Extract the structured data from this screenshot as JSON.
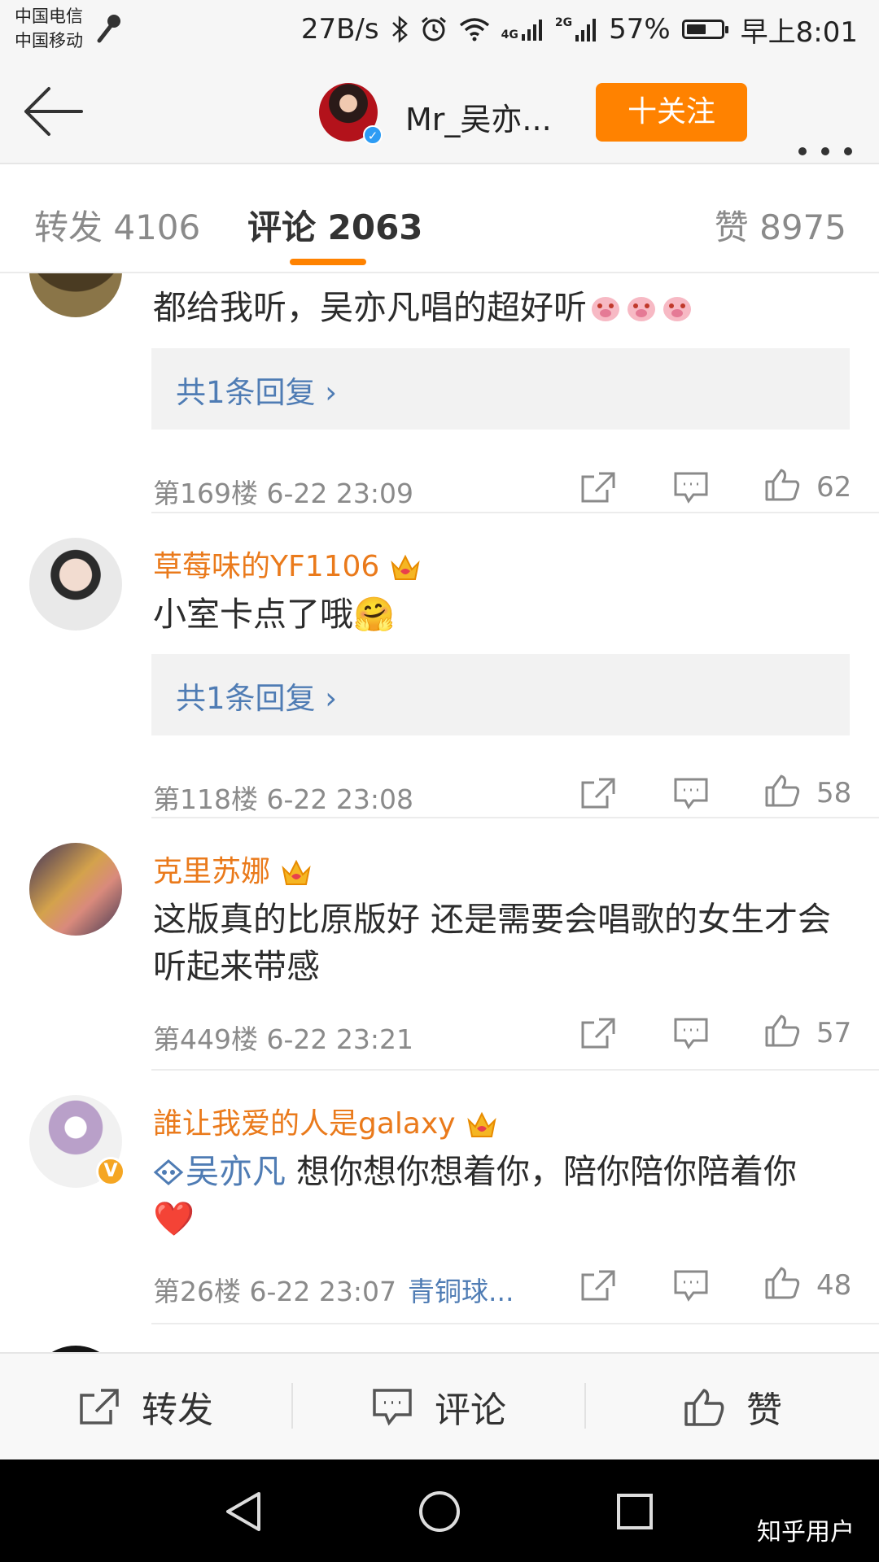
{
  "status_bar": {
    "carrier_1": "中国电信",
    "carrier_2": "中国移动",
    "net_speed": "27B/s",
    "network_label": "4G",
    "signal_2g_label": "2G",
    "battery": "57%",
    "battery_level": 0.57,
    "time": "早上8:01"
  },
  "header": {
    "account_name": "Mr_吴亦...",
    "follow_label": "十关注"
  },
  "tabs": [
    {
      "label": "转发 4106",
      "active": false
    },
    {
      "label": "评论 2063",
      "active": true
    },
    {
      "label": "赞 8975",
      "active": false
    }
  ],
  "comments": [
    {
      "username": "",
      "text": "都给我听，吴亦凡唱的超好听",
      "emoji_count": 3,
      "reply_summary": "共1条回复 ›",
      "floor_time": "第169楼 6-22 23:09",
      "likes": "62"
    },
    {
      "username": "草莓味的YF1106",
      "text": "小室卡点了哦🤗",
      "reply_summary": "共1条回复 ›",
      "floor_time": "第118楼 6-22 23:08",
      "likes": "58"
    },
    {
      "username": "克里苏娜",
      "text": "这版真的比原版好 还是需要会唱歌的女生才会听起来带感",
      "floor_time": "第449楼 6-22 23:21",
      "likes": "57"
    },
    {
      "username": "誰让我爱的人是galaxy",
      "mention": "吴亦凡",
      "text": " 想你想你想着你，陪你陪你陪着你❤️",
      "floor_time": "第26楼 6-22 23:07",
      "tag": "青铜球...",
      "likes": "48"
    }
  ],
  "toolbar": {
    "repost_label": "转发",
    "comment_label": "评论",
    "like_label": "赞"
  },
  "watermark": "知乎用户",
  "colors": {
    "accent_orange": "#ff8200",
    "username_orange": "#ea7a1b",
    "link_blue": "#4f7cb4"
  }
}
